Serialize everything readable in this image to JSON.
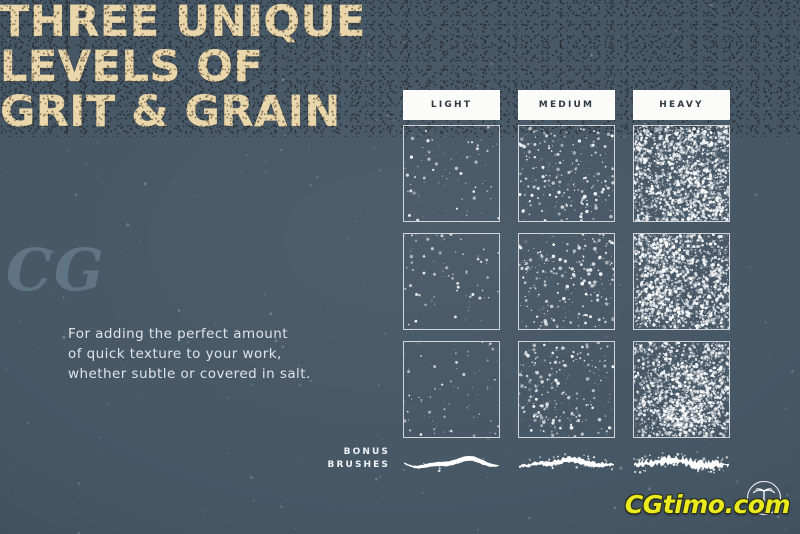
{
  "poster": {
    "background_color": "#455665",
    "headline_color": "#e9d6ab",
    "accent_color": "#eaea1e",
    "swatch_border_color": "#ffffff",
    "header_bg_color": "#fbfbf9",
    "header_text_color": "#2e3b46"
  },
  "headline": {
    "line1": "THREE UNIQUE",
    "line2": "LEVELS OF",
    "line3": "GRIT & GRAIN"
  },
  "subcopy": {
    "line1": "For adding the perfect amount",
    "line2": "of quick texture to your work,",
    "line3": "whether subtle or covered in salt."
  },
  "watermark_left": {
    "text": "CG"
  },
  "grid": {
    "columns": [
      {
        "label": "LIGHT",
        "density": "light"
      },
      {
        "label": "MEDIUM",
        "density": "medium"
      },
      {
        "label": "HEAVY",
        "density": "heavy"
      }
    ],
    "rows": 3
  },
  "bonus": {
    "label_line1": "BONUS",
    "label_line2": "BRUSHES",
    "brushes": [
      {
        "name": "brush-smooth"
      },
      {
        "name": "brush-textured"
      },
      {
        "name": "brush-rough"
      }
    ]
  },
  "watermark_brand": {
    "text": "CGtimo.com",
    "logo": "palm-tree-circle-icon"
  }
}
